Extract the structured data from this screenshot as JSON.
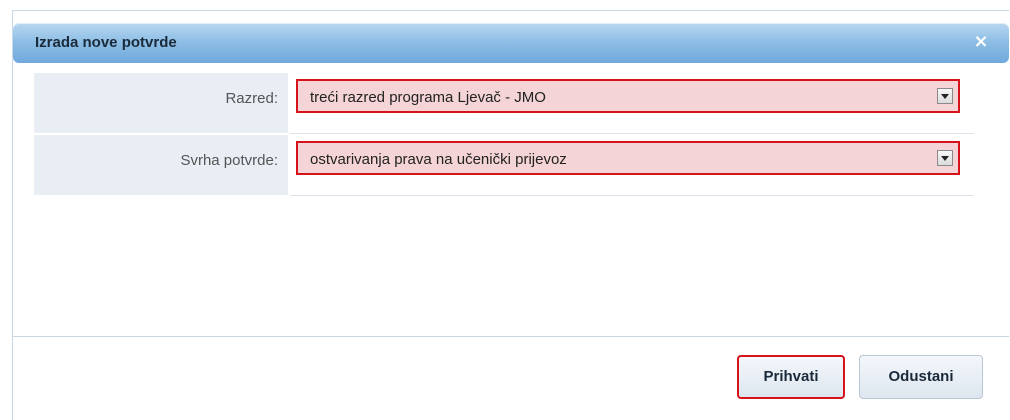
{
  "dialog": {
    "title": "Izrada nove potvrde",
    "close_label": "×"
  },
  "form": {
    "rows": [
      {
        "label": "Razred:",
        "value": "treći razred programa Ljevač - JMO"
      },
      {
        "label": "Svrha potvrde:",
        "value": "ostvarivanja prava na učenički prijevoz"
      }
    ]
  },
  "buttons": {
    "accept_label": "Prihvati",
    "cancel_label": "Odustani"
  },
  "colors": {
    "error_border": "#d6121b",
    "error_fill": "#f4d4d6",
    "titlebar": "#8fbfe5",
    "label_bg": "#e8eef4"
  }
}
